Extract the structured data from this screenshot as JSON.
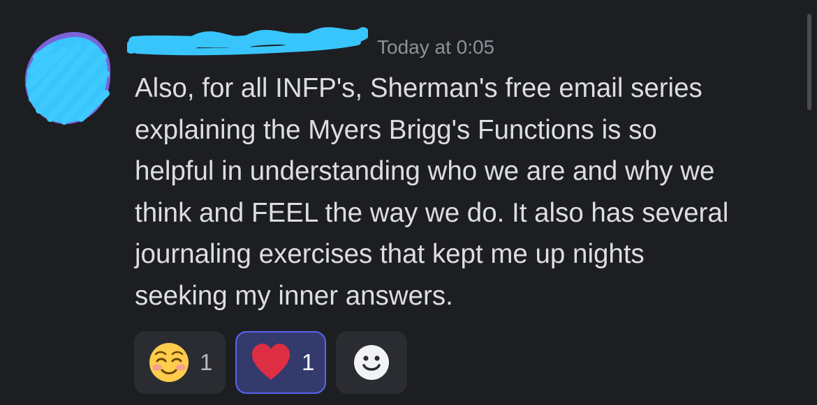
{
  "message": {
    "timestamp": "Today at 0:05",
    "content_lines": [
      "Also, for all INFP's, Sherman's free email series",
      "explaining the Myers Brigg's Functions is so",
      "helpful in understanding who we are and why we",
      "think and FEEL the way we do. It also has several",
      "journaling exercises that kept me up nights",
      "seeking my inner answers."
    ]
  },
  "reactions": [
    {
      "emoji": "smiling-face-icon",
      "count": "1",
      "selected": false
    },
    {
      "emoji": "red-heart-icon",
      "count": "1",
      "selected": true
    }
  ],
  "add_reaction": {
    "icon": "smiley-face-icon"
  },
  "colors": {
    "background": "#1d1e22",
    "text": "#dbdee1",
    "timestamp": "#8e9199",
    "redaction": "#38c5fc",
    "reaction_bg": "#2b2c31",
    "reaction_selected_bg": "#343a6c",
    "reaction_selected_border": "#5865f2"
  }
}
